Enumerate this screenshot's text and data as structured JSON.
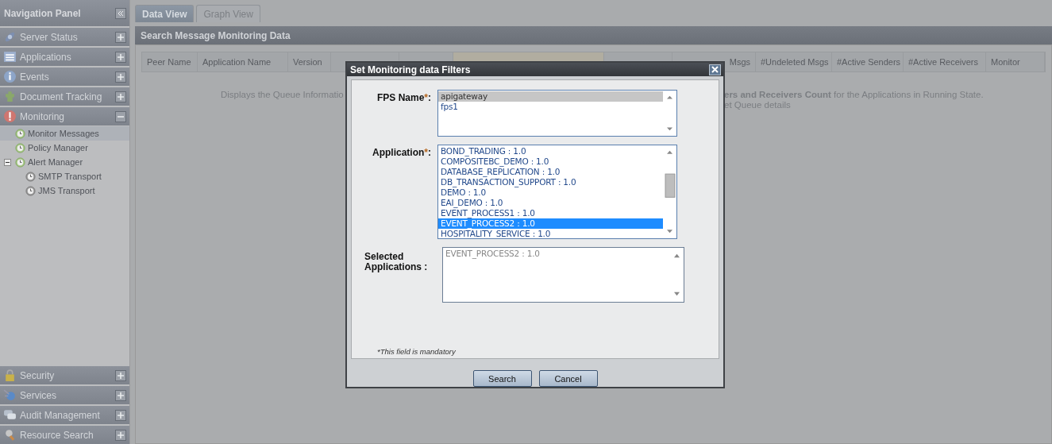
{
  "nav": {
    "title": "Navigation Panel",
    "sections": [
      {
        "label": "Server Status",
        "expanded": false
      },
      {
        "label": "Applications",
        "expanded": false
      },
      {
        "label": "Events",
        "expanded": false
      },
      {
        "label": "Document Tracking",
        "expanded": false
      },
      {
        "label": "Monitoring",
        "expanded": true,
        "children": [
          {
            "label": "Monitor Messages",
            "selected": true
          },
          {
            "label": "Policy Manager",
            "selected": false
          },
          {
            "label": "Alert Manager",
            "selected": false,
            "expanded": true,
            "children": [
              {
                "label": "SMTP Transport",
                "selected": false
              },
              {
                "label": "JMS Transport",
                "selected": false
              }
            ]
          }
        ]
      }
    ],
    "bottom_sections": [
      {
        "label": "Security",
        "expanded": false
      },
      {
        "label": "Services",
        "expanded": false
      },
      {
        "label": "Audit Management",
        "expanded": false
      },
      {
        "label": "Resource Search",
        "expanded": false
      }
    ]
  },
  "tabs": [
    {
      "label": "Data View",
      "selected": true
    },
    {
      "label": "Graph View",
      "selected": false
    }
  ],
  "panel": {
    "title": "Search Message Monitoring Data",
    "columns": [
      {
        "label": "Peer Name",
        "highlighted": false
      },
      {
        "label": "Application Name",
        "highlighted": false
      },
      {
        "label": "Version",
        "highlighted": false
      },
      {
        "highlighted": false
      },
      {
        "highlighted": false
      },
      {
        "highlighted": true
      },
      {
        "highlighted": false
      },
      {
        "label": "Msgs",
        "highlighted": false
      },
      {
        "label": "#Undeleted Msgs",
        "highlighted": false
      },
      {
        "label": "#Active Senders",
        "highlighted": false
      },
      {
        "label": "#Active Receivers",
        "highlighted": false
      },
      {
        "label": "Monitor",
        "highlighted": false
      }
    ],
    "message_left": "Displays the Queue Informatio",
    "message_right": [
      "**ers and Receivers Count** for the Applications in Running State.",
      "et Queue details"
    ]
  },
  "dialog": {
    "title": "Set Monitoring data Filters",
    "fps": {
      "label": "FPS Name",
      "items": [
        {
          "label": "apigateway",
          "selected": true
        },
        {
          "label": "fps1",
          "selected": false
        }
      ]
    },
    "application": {
      "label": "Application",
      "items": [
        {
          "label": "BOND_TRADING : 1.0",
          "selected": false
        },
        {
          "label": "COMPOSITEBC_DEMO : 1.0",
          "selected": false
        },
        {
          "label": "DATABASE_REPLICATION : 1.0",
          "selected": false
        },
        {
          "label": "DB_TRANSACTION_SUPPORT : 1.0",
          "selected": false
        },
        {
          "label": "DEMO : 1.0",
          "selected": false
        },
        {
          "label": "EAI_DEMO : 1.0",
          "selected": false
        },
        {
          "label": "EVENT_PROCESS1 : 1.0",
          "selected": false
        },
        {
          "label": "EVENT_PROCESS2 : 1.0",
          "selected": true
        },
        {
          "label": "HOSPITALITY_SERVICE : 1.0",
          "selected": false
        }
      ]
    },
    "selected_apps": {
      "label": "Selected Applications :",
      "items": [
        "EVENT_PROCESS2 : 1.0"
      ]
    },
    "required_mark": "*",
    "colon": ":",
    "note": "*This field is mandatory",
    "buttons": [
      "Search",
      "Cancel"
    ]
  }
}
